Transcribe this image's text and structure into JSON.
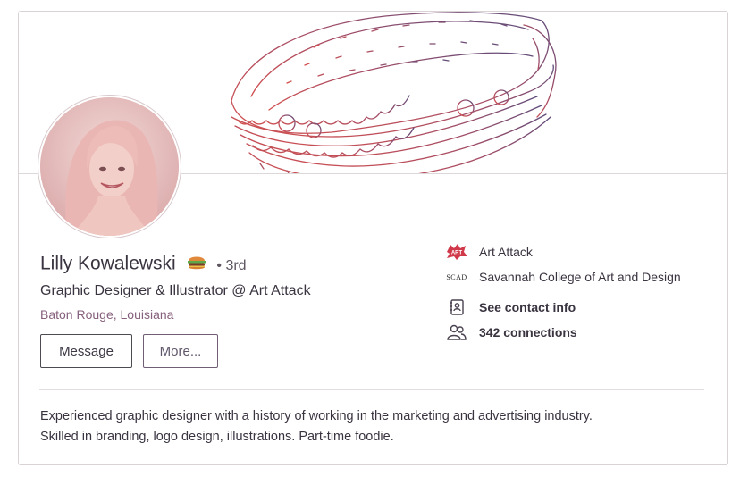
{
  "profile": {
    "name": "Lilly Kowalewski",
    "name_emoji": "hamburger-emoji",
    "degree": "• 3rd",
    "headline": "Graphic Designer & Illustrator @ Art Attack",
    "location": "Baton Rouge, Louisiana"
  },
  "actions": {
    "message_label": "Message",
    "more_label": "More..."
  },
  "side": {
    "company": "Art Attack",
    "company_logo_text": "ART",
    "school": "Savannah College of Art and Design",
    "school_logo_text": "SCAD",
    "contact_label": "See contact info",
    "connections_label": "342 connections"
  },
  "summary": {
    "line1": "Experienced graphic designer with a history of working in the marketing and advertising industry.",
    "line2": "Skilled in branding, logo design, illustrations. Part-time foodie."
  },
  "colors": {
    "accent_red": "#c84a4a",
    "accent_purple": "#6a4f7c",
    "location_text": "#86607c"
  },
  "icons": [
    "sandwich-illustration",
    "avatar-photo",
    "burger-icon",
    "art-attack-logo",
    "scad-logo",
    "contact-card-icon",
    "people-icon"
  ]
}
